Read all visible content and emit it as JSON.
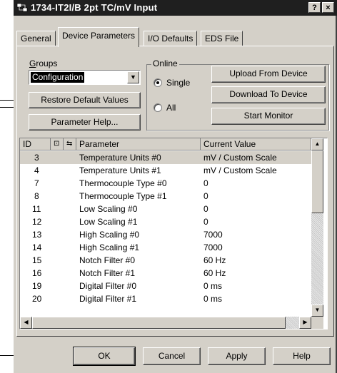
{
  "window": {
    "title": "1734-IT2I/B 2pt TC/mV Input",
    "help_btn": "?",
    "close_btn": "×"
  },
  "tabs": [
    "General",
    "Device Parameters",
    "I/O Defaults",
    "EDS File"
  ],
  "groups": {
    "label": "Groups",
    "selected": "Configuration",
    "restore_btn": "Restore Default Values",
    "param_help_btn": "Parameter Help..."
  },
  "online": {
    "label": "Online",
    "single": "Single",
    "all": "All",
    "selected": "Single",
    "upload_btn": "Upload From Device",
    "download_btn": "Download To Device",
    "monitor_btn": "Start Monitor"
  },
  "table": {
    "headers": {
      "id": "ID",
      "parameter": "Parameter",
      "value": "Current Value"
    },
    "rows": [
      {
        "id": "3",
        "parameter": "Temperature Units #0",
        "value": "mV / Custom Scale"
      },
      {
        "id": "4",
        "parameter": "Temperature Units #1",
        "value": "mV / Custom Scale"
      },
      {
        "id": "7",
        "parameter": "Thermocouple Type #0",
        "value": "0"
      },
      {
        "id": "8",
        "parameter": "Thermocouple Type #1",
        "value": "0"
      },
      {
        "id": "11",
        "parameter": "Low Scaling #0",
        "value": "0"
      },
      {
        "id": "12",
        "parameter": "Low Scaling #1",
        "value": "0"
      },
      {
        "id": "13",
        "parameter": "High Scaling #0",
        "value": "7000"
      },
      {
        "id": "14",
        "parameter": "High Scaling #1",
        "value": "7000"
      },
      {
        "id": "15",
        "parameter": "Notch Filter #0",
        "value": "60 Hz"
      },
      {
        "id": "16",
        "parameter": "Notch Filter #1",
        "value": "60 Hz"
      },
      {
        "id": "19",
        "parameter": "Digital Filter #0",
        "value": "0 ms"
      },
      {
        "id": "20",
        "parameter": "Digital Filter #1",
        "value": "0 ms"
      }
    ]
  },
  "footer": {
    "ok": "OK",
    "cancel": "Cancel",
    "apply": "Apply",
    "help": "Help"
  }
}
